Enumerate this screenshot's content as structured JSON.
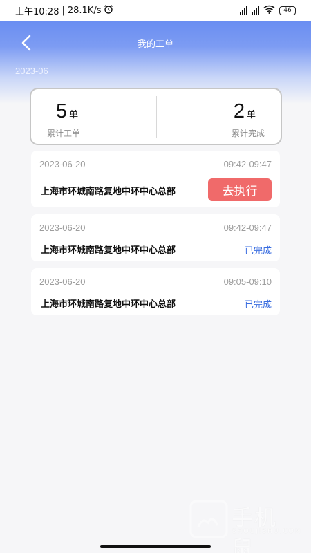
{
  "statusbar": {
    "time": "上午10:28",
    "speed": "28.1K/s",
    "battery": "46"
  },
  "header": {
    "title": "我的工单",
    "month": "2023-06"
  },
  "summary": {
    "total": {
      "value": "5",
      "unit": "单",
      "label": "累计工单"
    },
    "done": {
      "value": "2",
      "unit": "单",
      "label": "累计完成"
    }
  },
  "orders": [
    {
      "date": "2023-06-20",
      "time": "09:42-09:47",
      "address": "上海市环城南路复地中环中心总部",
      "action": "去执行"
    },
    {
      "date": "2023-06-20",
      "time": "09:42-09:47",
      "address": "上海市环城南路复地中环中心总部",
      "status": "已完成"
    },
    {
      "date": "2023-06-20",
      "time": "09:05-09:10",
      "address": "上海市环城南路复地中环中心总部",
      "status": "已完成"
    }
  ],
  "watermark": {
    "cn": "手机鼠",
    "en": "SHOUJISHU.COM"
  },
  "colors": {
    "accent": "#5a82f0",
    "action": "#f06a6a",
    "done": "#3a6de0"
  }
}
